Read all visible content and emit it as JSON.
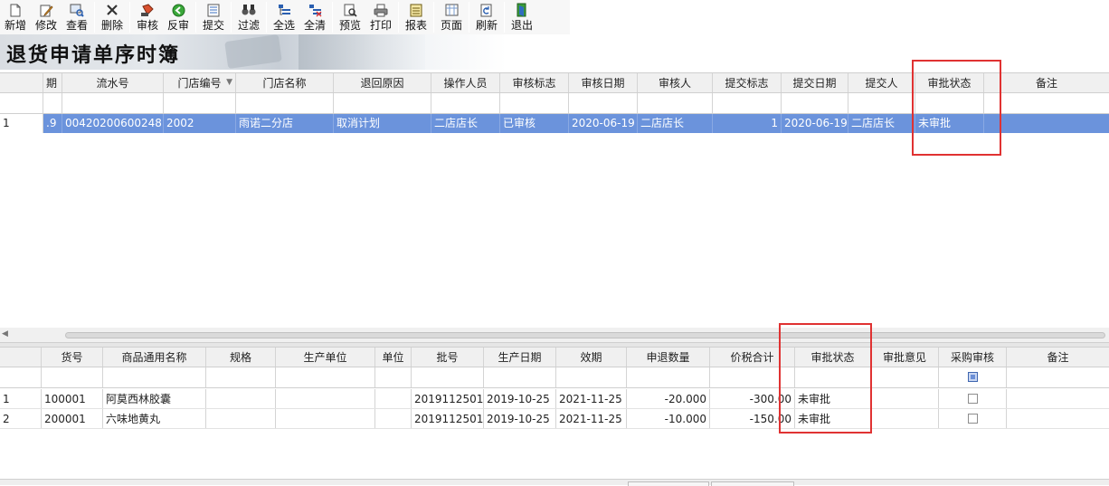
{
  "toolbar": {
    "buttons": [
      {
        "label": "新增",
        "icon": "new-file-icon"
      },
      {
        "label": "修改",
        "icon": "edit-icon"
      },
      {
        "label": "查看",
        "icon": "view-icon"
      },
      {
        "label": "删除",
        "icon": "delete-icon"
      },
      {
        "label": "审核",
        "icon": "approve-icon"
      },
      {
        "label": "反审",
        "icon": "unapprove-icon"
      },
      {
        "label": "提交",
        "icon": "submit-icon"
      },
      {
        "label": "过滤",
        "icon": "binoculars-icon"
      },
      {
        "label": "全选",
        "icon": "select-all-icon"
      },
      {
        "label": "全清",
        "icon": "clear-all-icon"
      },
      {
        "label": "预览",
        "icon": "preview-icon"
      },
      {
        "label": "打印",
        "icon": "printer-icon"
      },
      {
        "label": "报表",
        "icon": "report-icon"
      },
      {
        "label": "页面",
        "icon": "page-icon"
      },
      {
        "label": "刷新",
        "icon": "refresh-icon"
      },
      {
        "label": "退出",
        "icon": "exit-icon"
      }
    ]
  },
  "banner": {
    "title": "退货申请单序时簿"
  },
  "master": {
    "columns": [
      "期",
      "流水号",
      "门店编号",
      "门店名称",
      "退回原因",
      "操作人员",
      "审核标志",
      "审核日期",
      "审核人",
      "提交标志",
      "提交日期",
      "提交人",
      "审批状态",
      "备注"
    ],
    "rows": [
      {
        "row_no": "1",
        "period": ".9",
        "serial": "00420200600248",
        "store_code": "2002",
        "store_name": "雨诺二分店",
        "reason": "取消计划",
        "operator": "二店店长",
        "audit_flag": "已审核",
        "audit_date": "2020-06-19",
        "auditor": "二店店长",
        "submit_flag": "1",
        "submit_date": "2020-06-19",
        "submitter": "二店店长",
        "approval_status": "未审批",
        "remark": ""
      }
    ]
  },
  "detail": {
    "columns": [
      "货号",
      "商品通用名称",
      "规格",
      "生产单位",
      "单位",
      "批号",
      "生产日期",
      "效期",
      "申退数量",
      "价税合计",
      "审批状态",
      "审批意见",
      "采购审核",
      "备注"
    ],
    "rows": [
      {
        "row_no": "1",
        "item_no": "100001",
        "name": "阿莫西林胶囊",
        "spec": "",
        "maker": "",
        "unit": "",
        "batch": "2019112501",
        "mfg_date": "2019-10-25",
        "expiry": "2021-11-25",
        "qty": "-20.000",
        "amount": "-300.00",
        "approval_status": "未审批",
        "opinion": "",
        "purchase_check": false,
        "remark": ""
      },
      {
        "row_no": "2",
        "item_no": "200001",
        "name": "六味地黄丸",
        "spec": "",
        "maker": "",
        "unit": "",
        "batch": "2019112501",
        "mfg_date": "2019-10-25",
        "expiry": "2021-11-25",
        "qty": "-10.000",
        "amount": "-150.00",
        "approval_status": "未审批",
        "opinion": "",
        "purchase_check": false,
        "remark": ""
      }
    ]
  },
  "colors": {
    "selection": "#6b93dc",
    "highlight_box": "#e03232",
    "header_bg": "#f0f0f0"
  }
}
